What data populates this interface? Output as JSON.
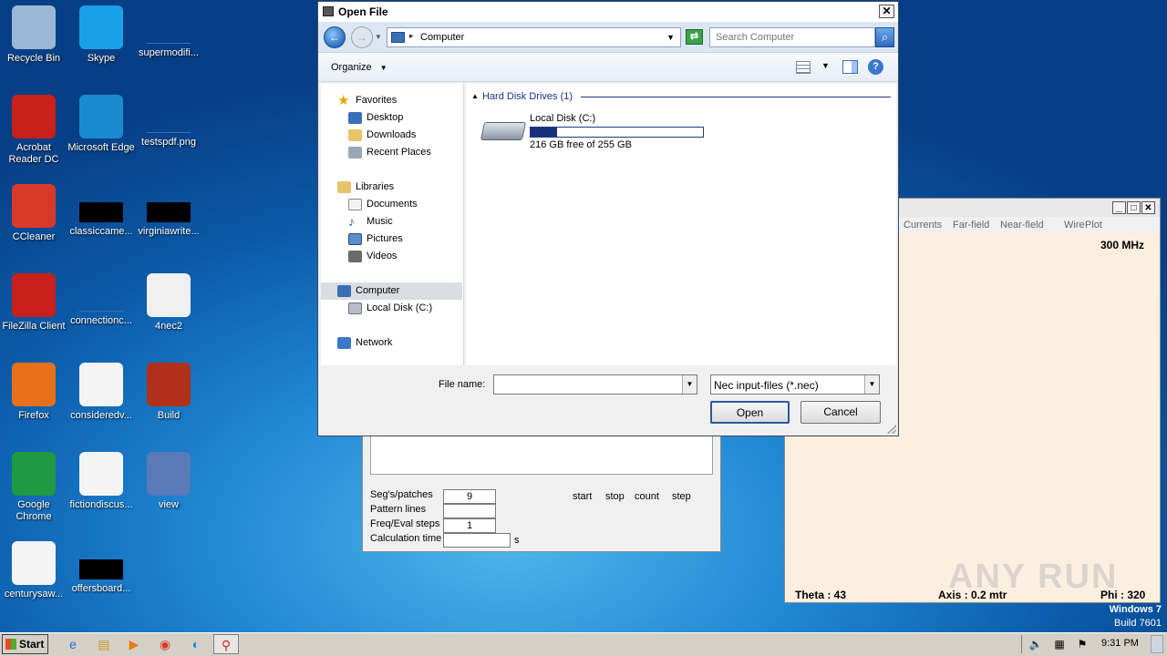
{
  "desktop": {
    "icons": [
      {
        "label": "Recycle Bin"
      },
      {
        "label": "Skype"
      },
      {
        "label": "supermodifi..."
      },
      {
        "label": "Acrobat Reader DC"
      },
      {
        "label": "Microsoft Edge"
      },
      {
        "label": "testspdf.png"
      },
      {
        "label": "CCleaner"
      },
      {
        "label": "classiccame..."
      },
      {
        "label": "virginiawrite..."
      },
      {
        "label": "FileZilla Client"
      },
      {
        "label": "connectionc..."
      },
      {
        "label": "4nec2"
      },
      {
        "label": "Firefox"
      },
      {
        "label": "consideredv..."
      },
      {
        "label": "Build"
      },
      {
        "label": "Google Chrome"
      },
      {
        "label": "fictiondiscus..."
      },
      {
        "label": "view"
      },
      {
        "label": "centurysaw..."
      },
      {
        "label": "offersboard..."
      }
    ],
    "watermark": {
      "text": "ANY RUN"
    },
    "os_badge": {
      "line1": "Windows 7",
      "line2": "Build 7601"
    }
  },
  "open_file": {
    "title": "Open File",
    "close": "✕",
    "address": "Computer",
    "search_placeholder": "Search Computer",
    "organize": "Organize",
    "nav": {
      "favorites": "Favorites",
      "desktop": "Desktop",
      "downloads": "Downloads",
      "recent": "Recent Places",
      "libraries": "Libraries",
      "documents": "Documents",
      "music": "Music",
      "pictures": "Pictures",
      "videos": "Videos",
      "computer": "Computer",
      "local_disk": "Local Disk (C:)",
      "network": "Network"
    },
    "group_header": "Hard Disk Drives (1)",
    "drive": {
      "name": "Local Disk (C:)",
      "free_text": "216 GB free of 255 GB",
      "used_fraction": 0.153
    },
    "filename_label": "File name:",
    "filename_value": "",
    "filetype": "Nec input-files (*.nec)",
    "open_button": "Open",
    "cancel_button": "Cancel"
  },
  "nec_main": {
    "labels": {
      "segs": "Seg's/patches",
      "pattern": "Pattern lines",
      "freq": "Freq/Eval steps",
      "calc": "Calculation time",
      "unit": "s"
    },
    "values": {
      "segs": "9",
      "pattern": "",
      "freq": "1",
      "calc": ""
    },
    "cols": {
      "start": "start",
      "stop": "stop",
      "count": "count",
      "step": "step"
    }
  },
  "pattern_window": {
    "menu": [
      "Currents",
      "Far-field",
      "Near-field",
      "Wire",
      "Plot"
    ],
    "freq": "300 MHz",
    "theta": "Theta : 43",
    "axis": "Axis : 0.2 mtr",
    "phi": "Phi : 320"
  },
  "taskbar": {
    "start": "Start",
    "clock": "9:31 PM"
  }
}
